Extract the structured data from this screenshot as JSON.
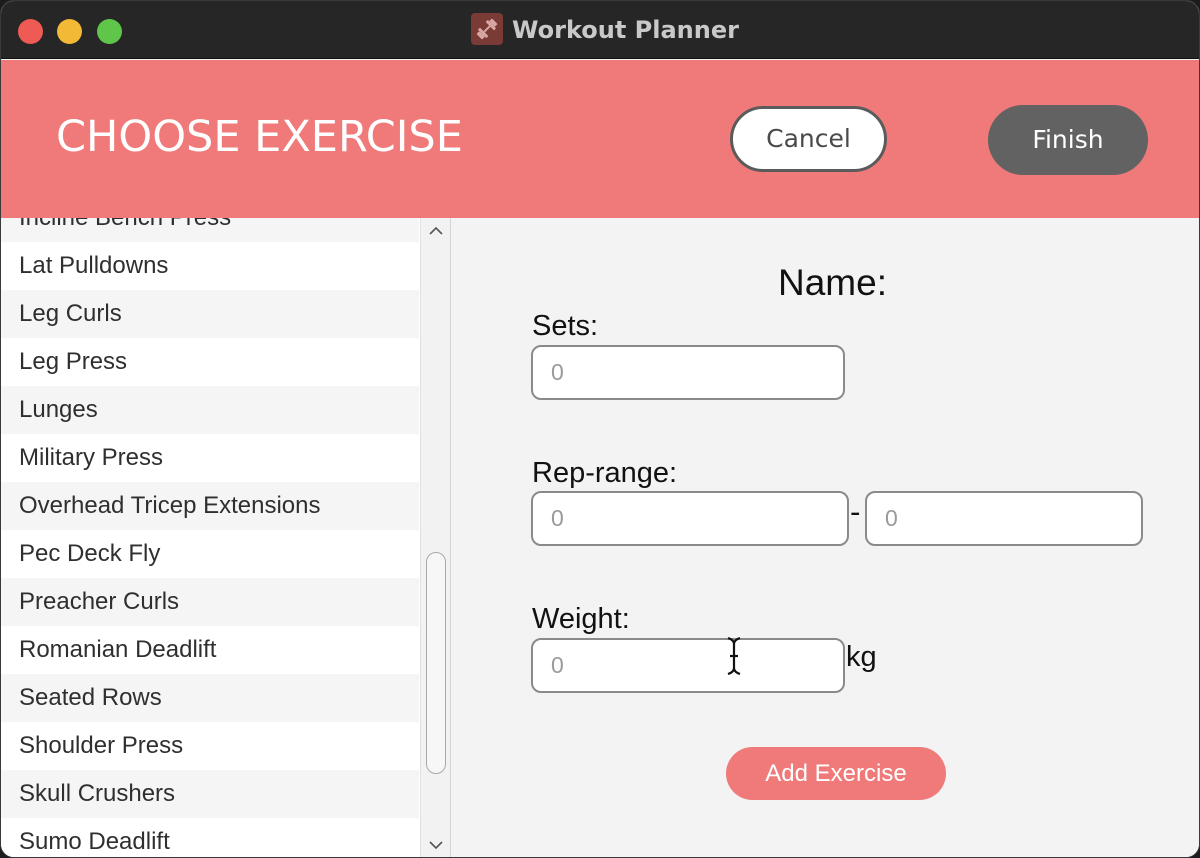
{
  "window": {
    "title": "Workout Planner"
  },
  "header": {
    "title": "CHOOSE EXERCISE",
    "cancel_label": "Cancel",
    "finish_label": "Finish"
  },
  "exercise_list": {
    "items": [
      "Incline Bench Press",
      "Lat Pulldowns",
      "Leg Curls",
      "Leg Press",
      "Lunges",
      "Military Press",
      "Overhead Tricep Extensions",
      "Pec Deck Fly",
      "Preacher Curls",
      "Romanian Deadlift",
      "Seated Rows",
      "Shoulder Press",
      "Skull Crushers",
      "Sumo Deadlift"
    ]
  },
  "form": {
    "name_label": "Name:",
    "sets_label": "Sets:",
    "sets_placeholder": "0",
    "rep_range_label": "Rep-range:",
    "rep_min_placeholder": "0",
    "rep_separator": "-",
    "rep_max_placeholder": "0",
    "weight_label": "Weight:",
    "weight_placeholder": "0",
    "weight_unit": "kg",
    "add_button_label": "Add Exercise"
  },
  "colors": {
    "accent": "#ef7a79",
    "finish_button": "#626262",
    "titlebar": "#262626"
  },
  "icons": {
    "app_icon": "dumbbell-icon",
    "scroll_up": "chevron-up-icon",
    "scroll_down": "chevron-down-icon",
    "cursor": "text-cursor-icon"
  }
}
